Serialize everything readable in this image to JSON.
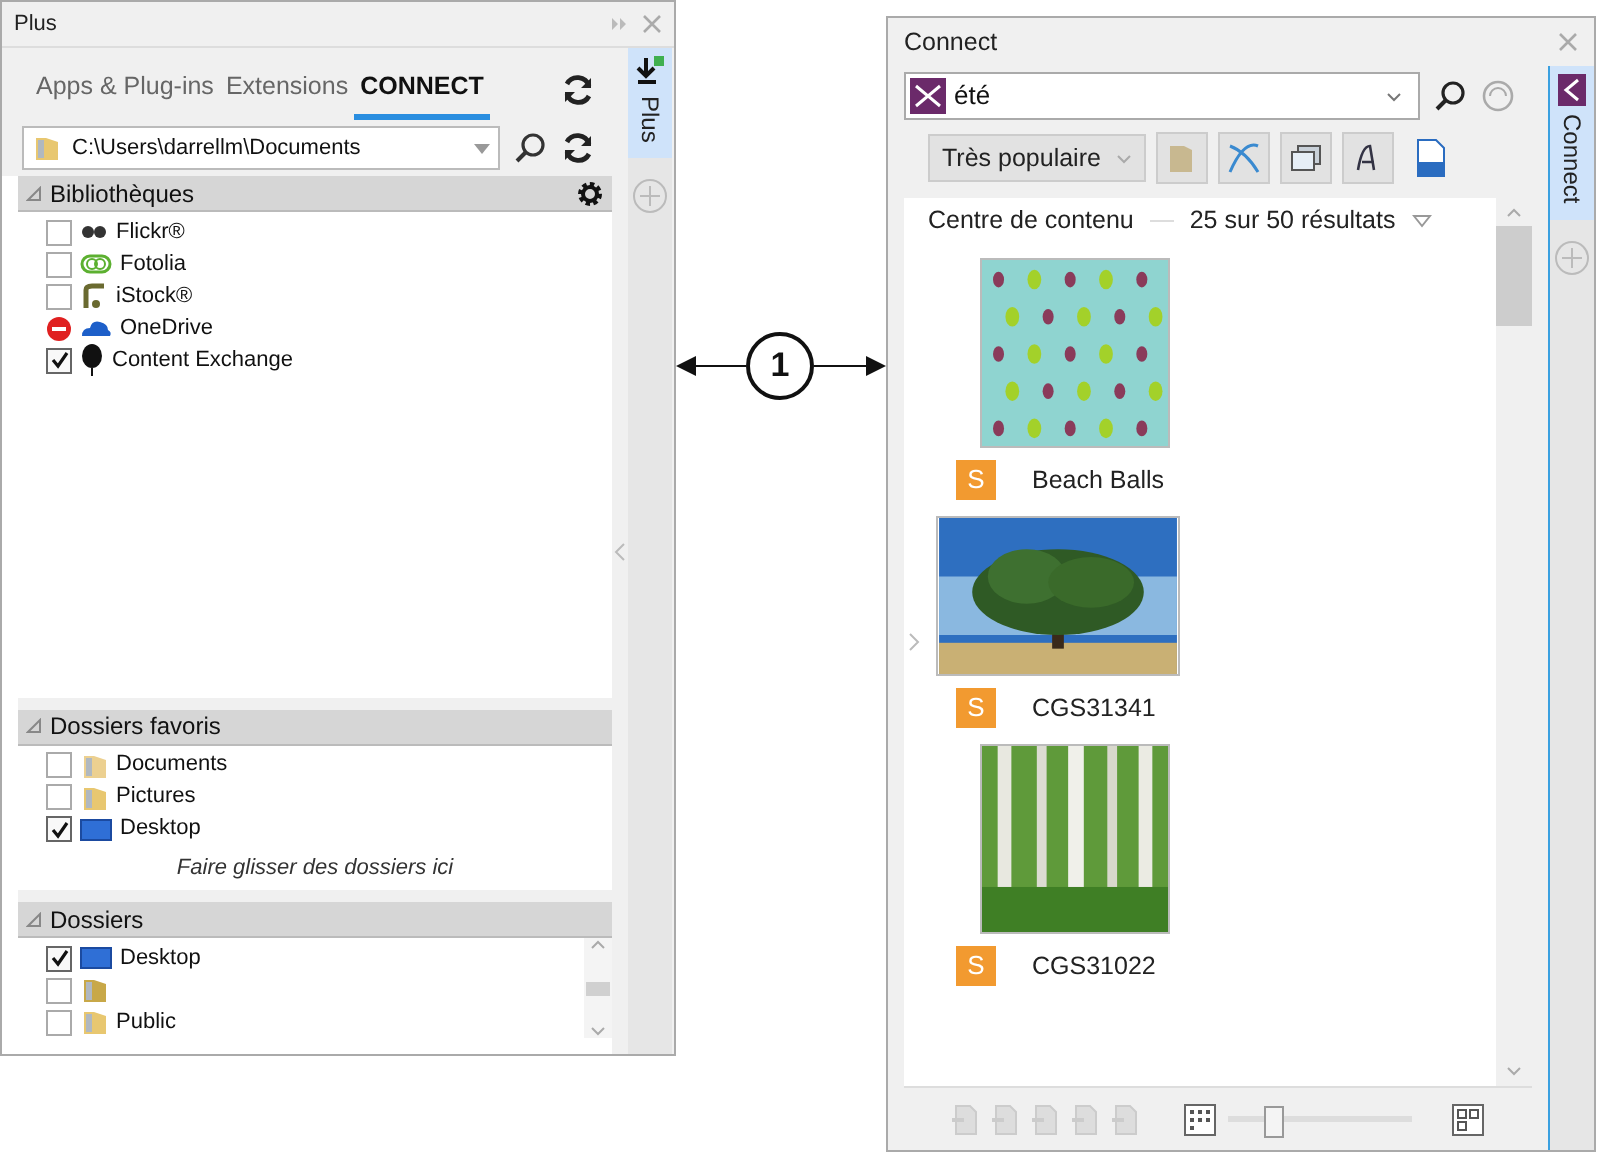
{
  "plus_panel": {
    "title": "Plus",
    "tabs": [
      {
        "label": "Apps & Plug-ins",
        "selected": false
      },
      {
        "label": "Extensions",
        "selected": false
      },
      {
        "label": "CONNECT",
        "selected": true
      }
    ],
    "path_field": {
      "value": "C:\\Users\\darrellm\\Documents"
    },
    "sections": [
      {
        "title": "Bibliothèques",
        "expanded": true,
        "items": [
          {
            "label": "Flickr®",
            "kind": "checkbox",
            "checked": false
          },
          {
            "label": "Fotolia",
            "kind": "checkbox",
            "checked": false
          },
          {
            "label": "iStock®",
            "kind": "checkbox",
            "checked": false
          },
          {
            "label": "OneDrive",
            "kind": "blocked"
          },
          {
            "label": "Content Exchange",
            "kind": "checkbox",
            "checked": true
          }
        ]
      },
      {
        "title": "Dossiers favoris",
        "expanded": true,
        "hint": "Faire glisser des dossiers ici",
        "items": [
          {
            "label": "Documents",
            "kind": "checkbox",
            "checked": false
          },
          {
            "label": "Pictures",
            "kind": "checkbox",
            "checked": false
          },
          {
            "label": "Desktop",
            "kind": "checkbox",
            "checked": true
          }
        ]
      },
      {
        "title": "Dossiers",
        "expanded": true,
        "items": [
          {
            "label": "Desktop",
            "kind": "checkbox",
            "checked": true
          },
          {
            "kind": "checkbox",
            "checked": false
          },
          {
            "label": "Public",
            "kind": "checkbox",
            "checked": false
          }
        ]
      }
    ],
    "side_tabs": [
      {
        "label": "Plus",
        "selected": true
      }
    ]
  },
  "callout": {
    "label": "1"
  },
  "connect_panel": {
    "title": "Connect",
    "search_field": {
      "value": "été"
    },
    "sort_dropdown": {
      "value": "Très populaire"
    },
    "header": {
      "source": "Centre de contenu",
      "count": "25 sur 50 résultats"
    },
    "results": [
      {
        "badge": "S",
        "title": "Beach Balls"
      },
      {
        "badge": "S",
        "title": "CGS31341"
      },
      {
        "badge": "S",
        "title": "CGS31022"
      }
    ],
    "thumbnail_size": {
      "level": 0.25
    },
    "side_tabs": [
      {
        "label": "Connect",
        "selected": true
      }
    ]
  }
}
